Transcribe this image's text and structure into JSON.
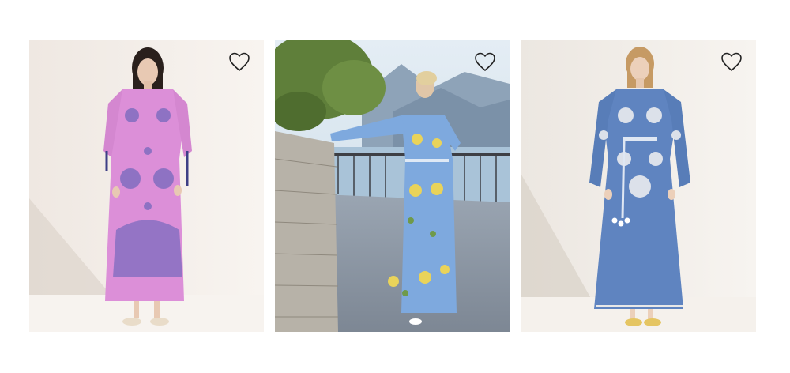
{
  "products": [
    {
      "favorite_icon": "heart-outline-icon",
      "dress_color": "#dc8fd8",
      "embroidery_color": "#5a5fb6",
      "background": "#f3ede8"
    },
    {
      "favorite_icon": "heart-outline-icon",
      "dress_color": "#7ea9de",
      "embroidery_color": "#e9d35a",
      "background": "#c9d9e8"
    },
    {
      "favorite_icon": "heart-outline-icon",
      "dress_color": "#5f84c0",
      "embroidery_color": "#f2f2f2",
      "background": "#efebe6"
    }
  ]
}
